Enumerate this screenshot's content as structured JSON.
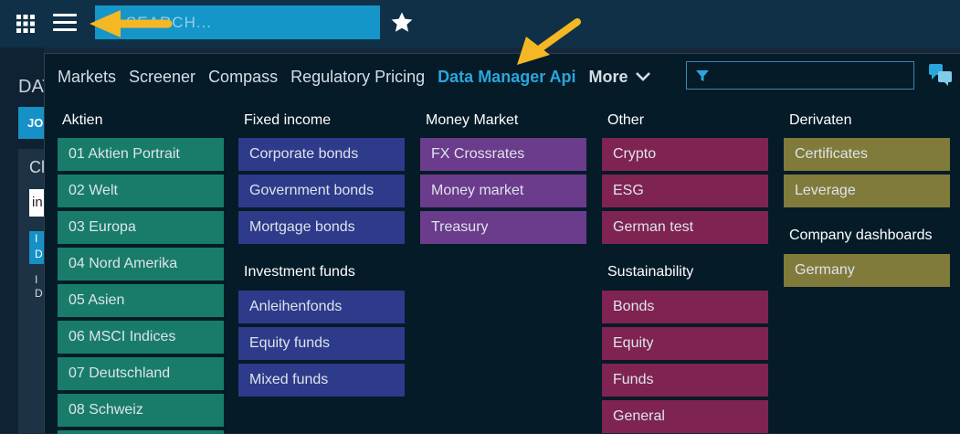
{
  "topbar": {
    "search_placeholder": "SEARCH...",
    "icons": [
      "apps-grid-icon",
      "hamburger-menu-icon",
      "star-icon"
    ]
  },
  "background": {
    "page_title": "DAT",
    "tab_label": "JO",
    "card_title": "Cl",
    "input_value": "in",
    "selected_text": "I\nD",
    "row_text": "I\nD"
  },
  "nav": {
    "items": [
      "Markets",
      "Screener",
      "Compass",
      "Regulatory Pricing",
      "Data Manager Api"
    ],
    "active": "Data Manager Api",
    "more_label": "More"
  },
  "sections": {
    "aktien": {
      "title": "Aktien",
      "items": [
        "01 Aktien Portrait",
        "02 Welt",
        "03 Europa",
        "04 Nord Amerika",
        "05 Asien",
        "06 MSCI Indices",
        "07 Deutschland",
        "08 Schweiz"
      ]
    },
    "fixed_income": {
      "title": "Fixed income",
      "items": [
        "Corporate bonds",
        "Government bonds",
        "Mortgage bonds"
      ]
    },
    "investment_funds": {
      "title": "Investment funds",
      "items": [
        "Anleihenfonds",
        "Equity funds",
        "Mixed funds"
      ]
    },
    "money_market": {
      "title": "Money Market",
      "items": [
        "FX Crossrates",
        "Money market",
        "Treasury"
      ]
    },
    "other": {
      "title": "Other",
      "items": [
        "Crypto",
        "ESG",
        "German test"
      ]
    },
    "sustainability": {
      "title": "Sustainability",
      "items": [
        "Bonds",
        "Equity",
        "Funds",
        "General"
      ]
    },
    "derivaten": {
      "title": "Derivaten",
      "items": [
        "Certificates",
        "Leverage"
      ]
    },
    "company_dashboards": {
      "title": "Company dashboards",
      "items": [
        "Germany"
      ]
    }
  },
  "colors": {
    "topbar": "#0f3047",
    "search": "#1596c8",
    "active_nav": "#2aa6dc",
    "aktien": "#197c6b",
    "fixed_income": "#2e3a8a",
    "money_market": "#6b3b8c",
    "other": "#7f2352",
    "derivaten": "#807b3b",
    "annotation_arrow": "#f5b723"
  }
}
